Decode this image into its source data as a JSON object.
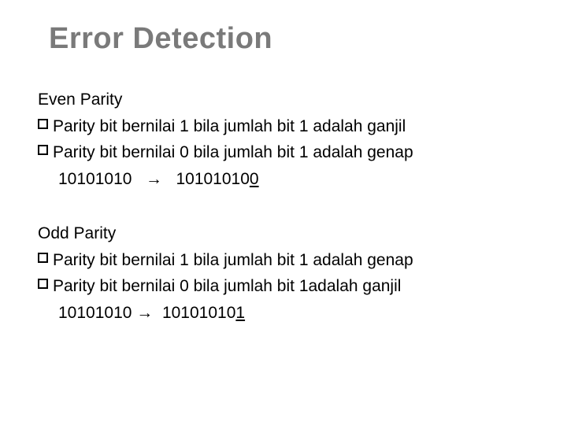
{
  "title": "Error Detection",
  "even": {
    "label": "Even Parity",
    "bullet1": "Parity bit bernilai 1 bila jumlah bit 1 adalah ganjil",
    "bullet2": "Parity bit bernilai 0 bila jumlah bit 1 adalah genap",
    "example_before": "10101010",
    "example_spacer": "   ",
    "arrow": "→",
    "example_after_prefix": "   10101010",
    "example_after_parity": "0"
  },
  "odd": {
    "label": "Odd Parity",
    "bullet1": "Parity bit bernilai 1 bila jumlah bit 1 adalah genap",
    "bullet2": "Parity bit bernilai 0 bila jumlah bit 1adalah ganjil",
    "example_before": "10101010 ",
    "arrow": "→",
    "example_after_prefix": "  10101010",
    "example_after_parity": "1"
  }
}
